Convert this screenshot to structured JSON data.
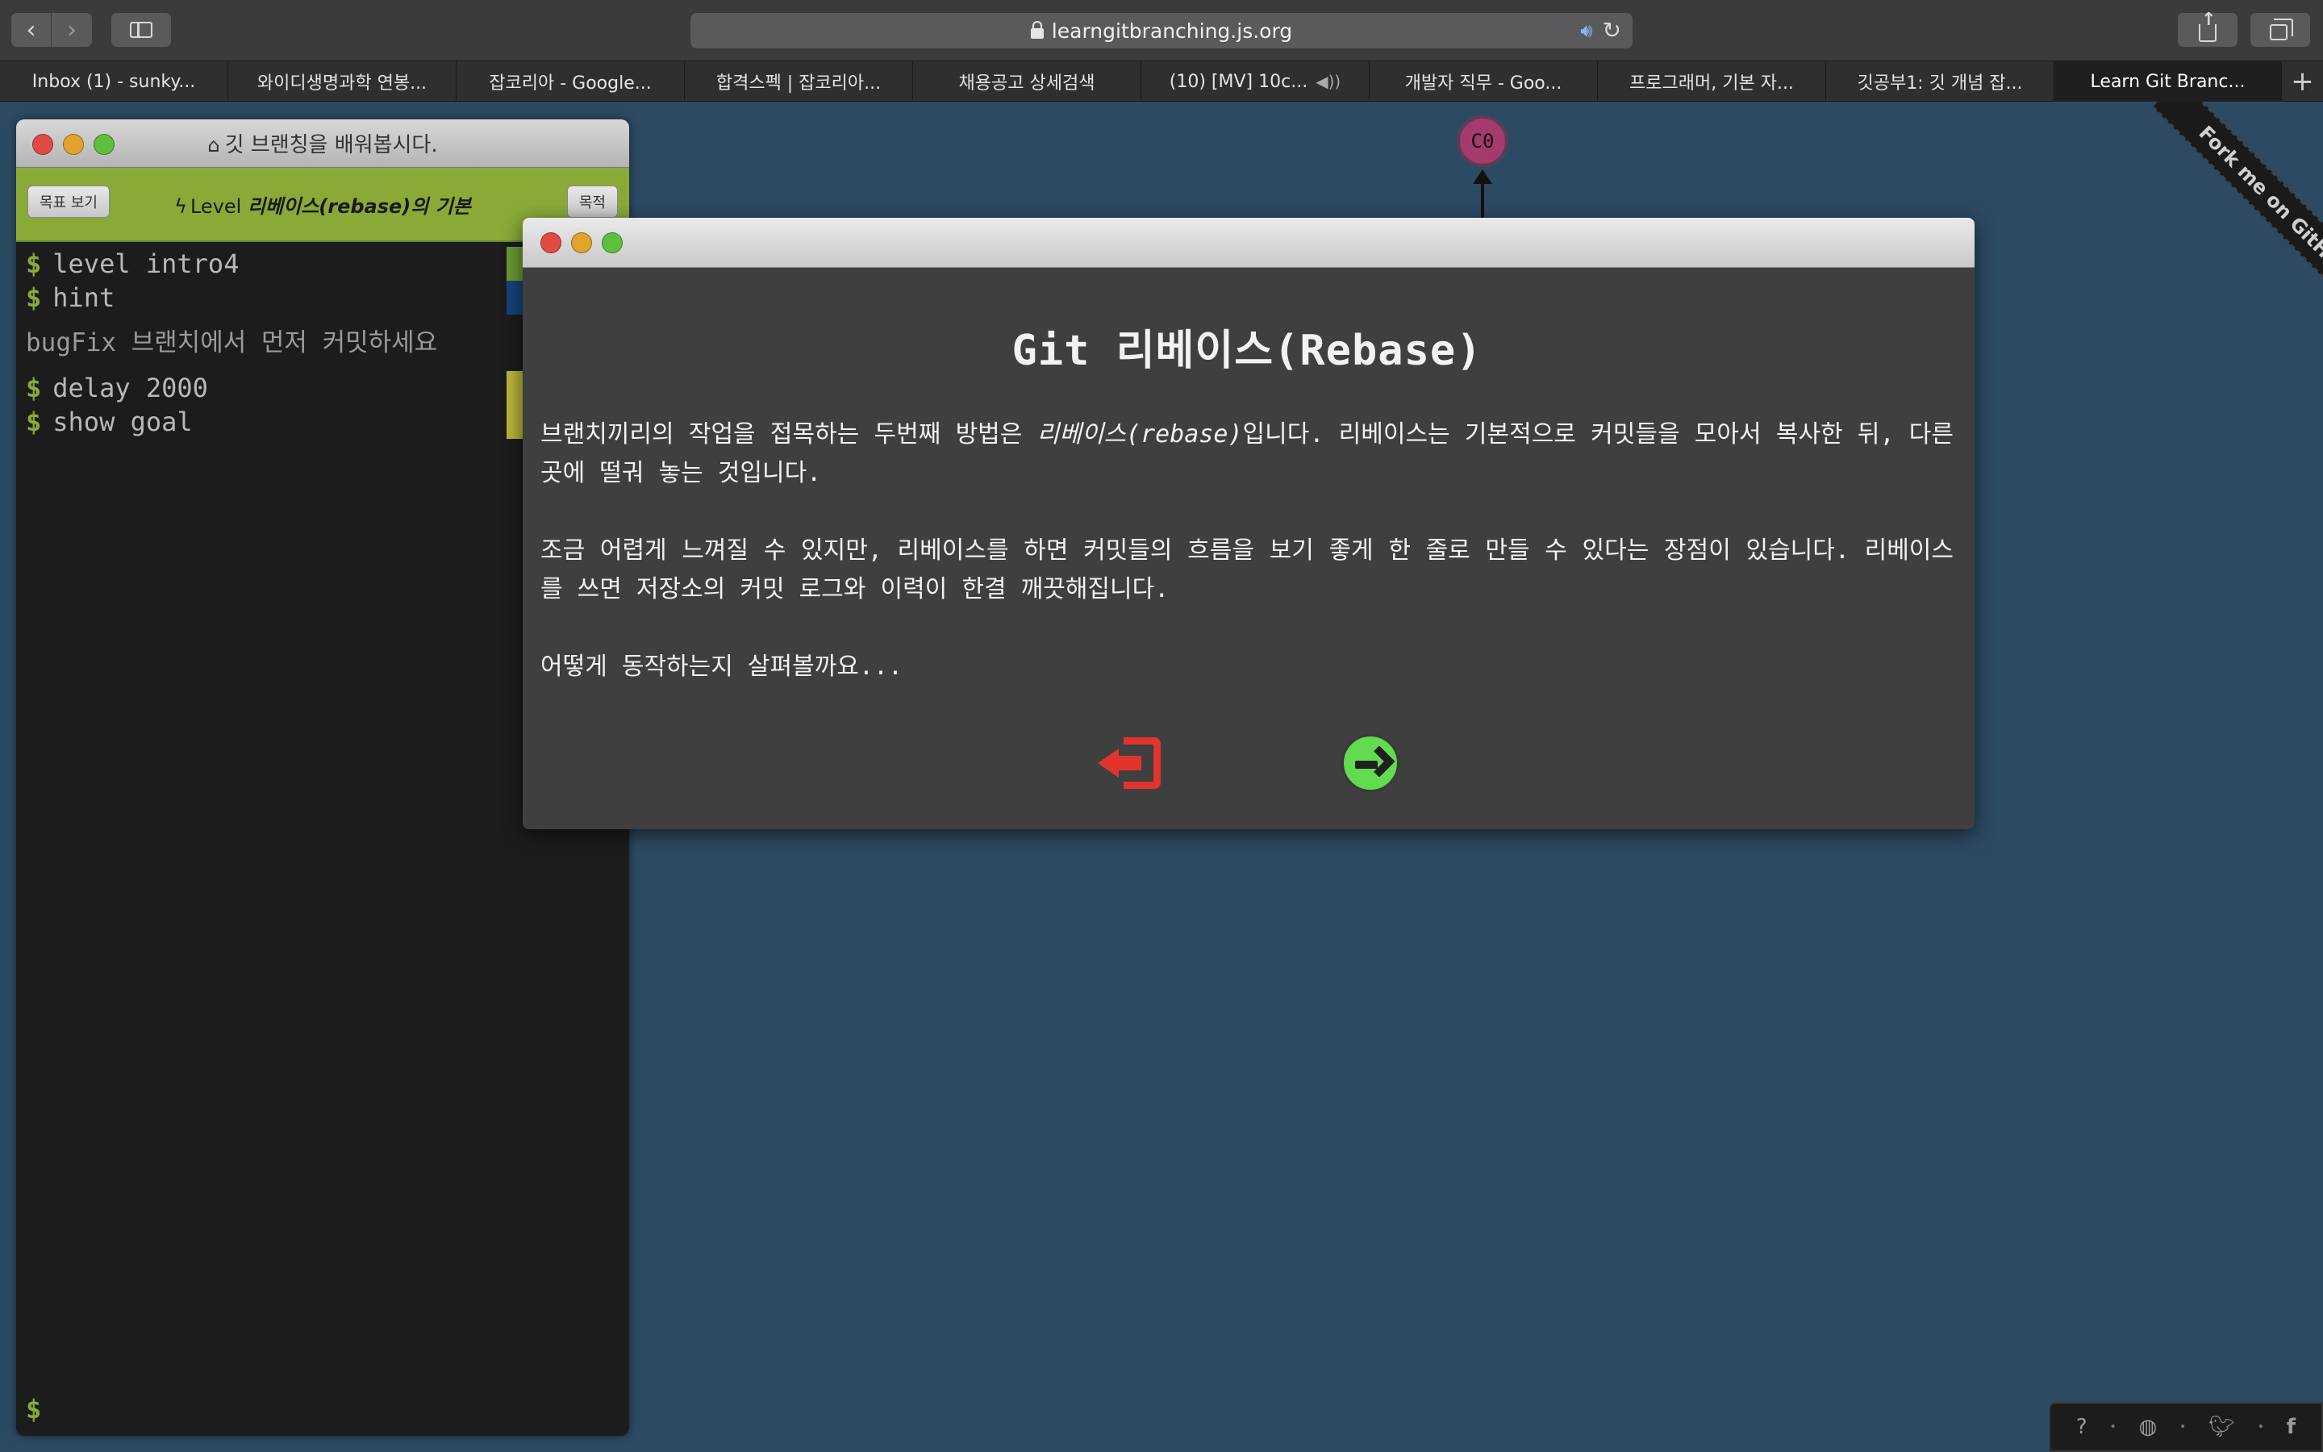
{
  "browser": {
    "url": "learngitbranching.js.org",
    "tabs": [
      {
        "label": "Inbox (1) - sunky...",
        "active": false,
        "audio": false
      },
      {
        "label": "와이디생명과학 연봉...",
        "active": false,
        "audio": false
      },
      {
        "label": "잡코리아 - Google...",
        "active": false,
        "audio": false
      },
      {
        "label": "합격스펙 | 잡코리아...",
        "active": false,
        "audio": false
      },
      {
        "label": "채용공고 상세검색",
        "active": false,
        "audio": false
      },
      {
        "label": "(10) [MV] 10c...",
        "active": false,
        "audio": true
      },
      {
        "label": "개발자 직무 - Goo...",
        "active": false,
        "audio": false
      },
      {
        "label": "프로그래머, 기본 자...",
        "active": false,
        "audio": false
      },
      {
        "label": "깃공부1: 깃 개념 잡...",
        "active": false,
        "audio": false
      },
      {
        "label": "Learn Git Branc...",
        "active": true,
        "audio": false
      }
    ],
    "add_tab": "+"
  },
  "ribbon": {
    "label": "Fork me on GitHub"
  },
  "graph": {
    "commit_label": "C0",
    "commit_color": "#a43a6e"
  },
  "terminal": {
    "title": "깃 브랜칭을 배워봅시다.",
    "goal_button": "목표 보기",
    "objective_button": "목적",
    "level_prefix": "Level",
    "level_name": "리베이스(rebase)의 기본",
    "prompt": "$",
    "lines": [
      {
        "cmd": "level intro4",
        "status_color": "#6a9a32"
      },
      {
        "cmd": "hint",
        "status_color": "#17427a"
      }
    ],
    "hint_output": "bugFix 브랜치에서 먼저 커밋하세요",
    "lines2": [
      {
        "cmd": "delay 2000",
        "status_color": "#b8b53a"
      },
      {
        "cmd": "show goal",
        "status_color": "#b8b53a"
      }
    ]
  },
  "modal": {
    "heading": "Git 리베이스(Rebase)",
    "p1_before": "브랜치끼리의 작업을 접목하는 두번째 방법은 ",
    "p1_em": "리베이스(rebase)",
    "p1_after": "입니다. 리베이스는 기본적으로 커밋들을 모아서 복사한 뒤, 다른 곳에 떨궈 놓는 것입니다.",
    "p2": "조금 어렵게 느껴질 수 있지만, 리베이스를 하면 커밋들의 흐름을 보기 좋게 한 줄로 만들 수 있다는 장점이 있습니다. 리베이스를 쓰면 저장소의 커밋 로그와 이력이 한결 깨끗해집니다.",
    "p3": "어떻게 동작하는지 살펴볼까요...",
    "exit_color": "#e2342d",
    "next_color": "#61dc4e"
  },
  "footer": {
    "icons": [
      "help-icon",
      "globe-icon",
      "twitter-icon",
      "facebook-icon"
    ]
  }
}
